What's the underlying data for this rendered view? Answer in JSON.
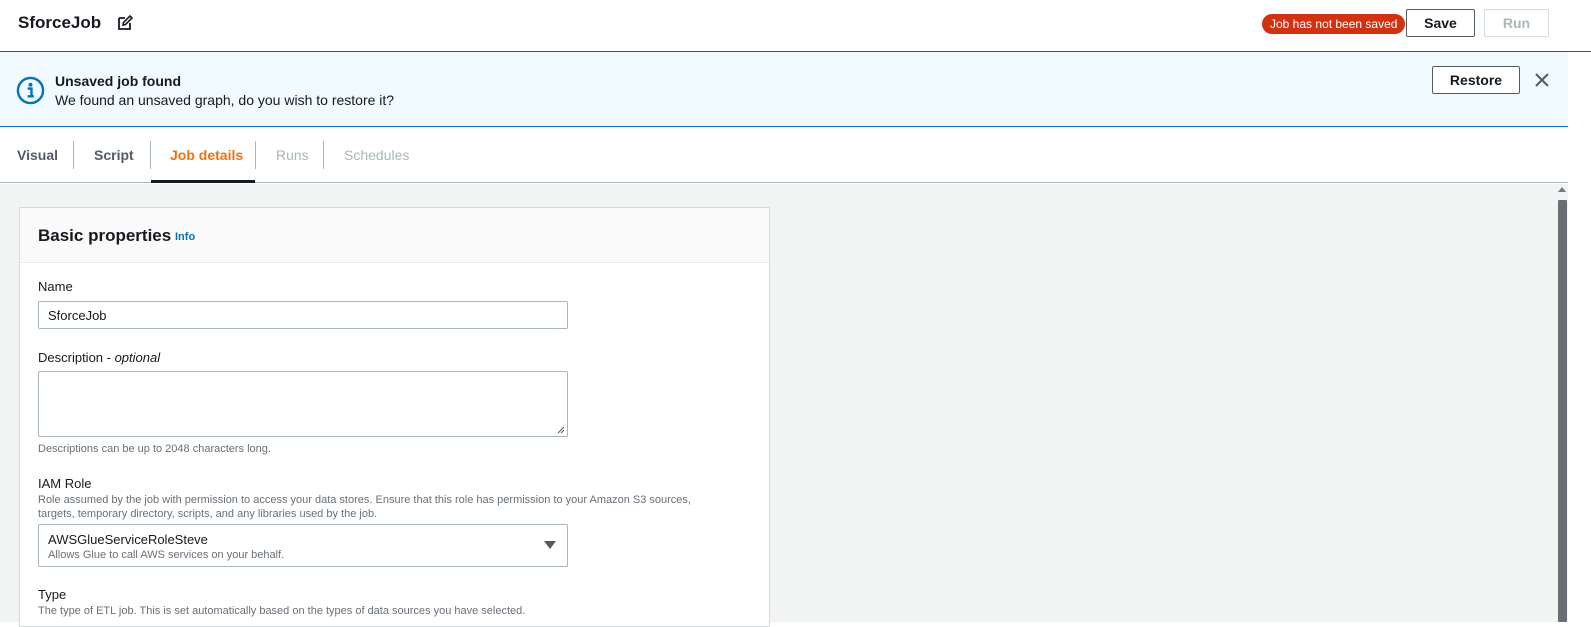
{
  "header": {
    "job_title": "SforceJob",
    "status_badge": "Job has not been saved",
    "save_label": "Save",
    "run_label": "Run"
  },
  "flash": {
    "title": "Unsaved job found",
    "message": "We found an unsaved graph, do you wish to restore it?",
    "restore_label": "Restore"
  },
  "tabs": [
    {
      "label": "Visual",
      "state": "default"
    },
    {
      "label": "Script",
      "state": "default"
    },
    {
      "label": "Job details",
      "state": "active"
    },
    {
      "label": "Runs",
      "state": "disabled"
    },
    {
      "label": "Schedules",
      "state": "disabled"
    }
  ],
  "panel": {
    "title": "Basic properties",
    "info_link": "Info",
    "name": {
      "label": "Name",
      "value": "SforceJob"
    },
    "description": {
      "label": "Description - ",
      "label_optional": "optional",
      "value": "",
      "hint": "Descriptions can be up to 2048 characters long."
    },
    "iam_role": {
      "label": "IAM Role",
      "hint_line1": "Role assumed by the job with permission to access your data stores. Ensure that this role has permission to your Amazon S3 sources,",
      "hint_line2": "targets, temporary directory, scripts, and any libraries used by the job.",
      "selected_value": "AWSGlueServiceRoleSteve",
      "selected_desc": "Allows Glue to call AWS services on your behalf."
    },
    "type": {
      "label": "Type",
      "hint": "The type of ETL job. This is set automatically based on the types of data sources you have selected."
    }
  },
  "colors": {
    "accent_tab": "#ec7211",
    "badge_bg": "#d13212",
    "info_blue": "#0073bb",
    "flash_bg": "#f1faff"
  },
  "icons": {
    "edit": "edit-icon",
    "info": "info-circle-icon",
    "close": "close-icon",
    "dropdown": "caret-down-icon"
  }
}
